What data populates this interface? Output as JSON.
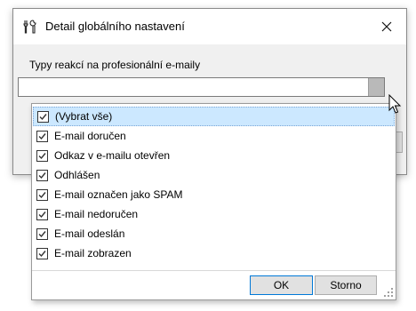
{
  "dialog": {
    "title": "Detail globálního nastavení",
    "title_icon": "tools-icon",
    "close_icon": "close-icon"
  },
  "form": {
    "label": "Typy reakcí na profesionální e-maily",
    "combo_value": ""
  },
  "dropdown": {
    "items": [
      {
        "label": "(Vybrat vše)",
        "checked": true,
        "selected": true
      },
      {
        "label": "E-mail doručen",
        "checked": true
      },
      {
        "label": "Odkaz v e-mailu otevřen",
        "checked": true
      },
      {
        "label": "Odhlášen",
        "checked": true
      },
      {
        "label": "E-mail označen jako SPAM",
        "checked": true
      },
      {
        "label": "E-mail nedoručen",
        "checked": true
      },
      {
        "label": "E-mail odeslán",
        "checked": true
      },
      {
        "label": "E-mail zobrazen",
        "checked": true
      }
    ],
    "ok_label": "OK",
    "cancel_label": "Storno"
  },
  "colors": {
    "selection": "#cce8ff",
    "accent": "#0078d7"
  }
}
